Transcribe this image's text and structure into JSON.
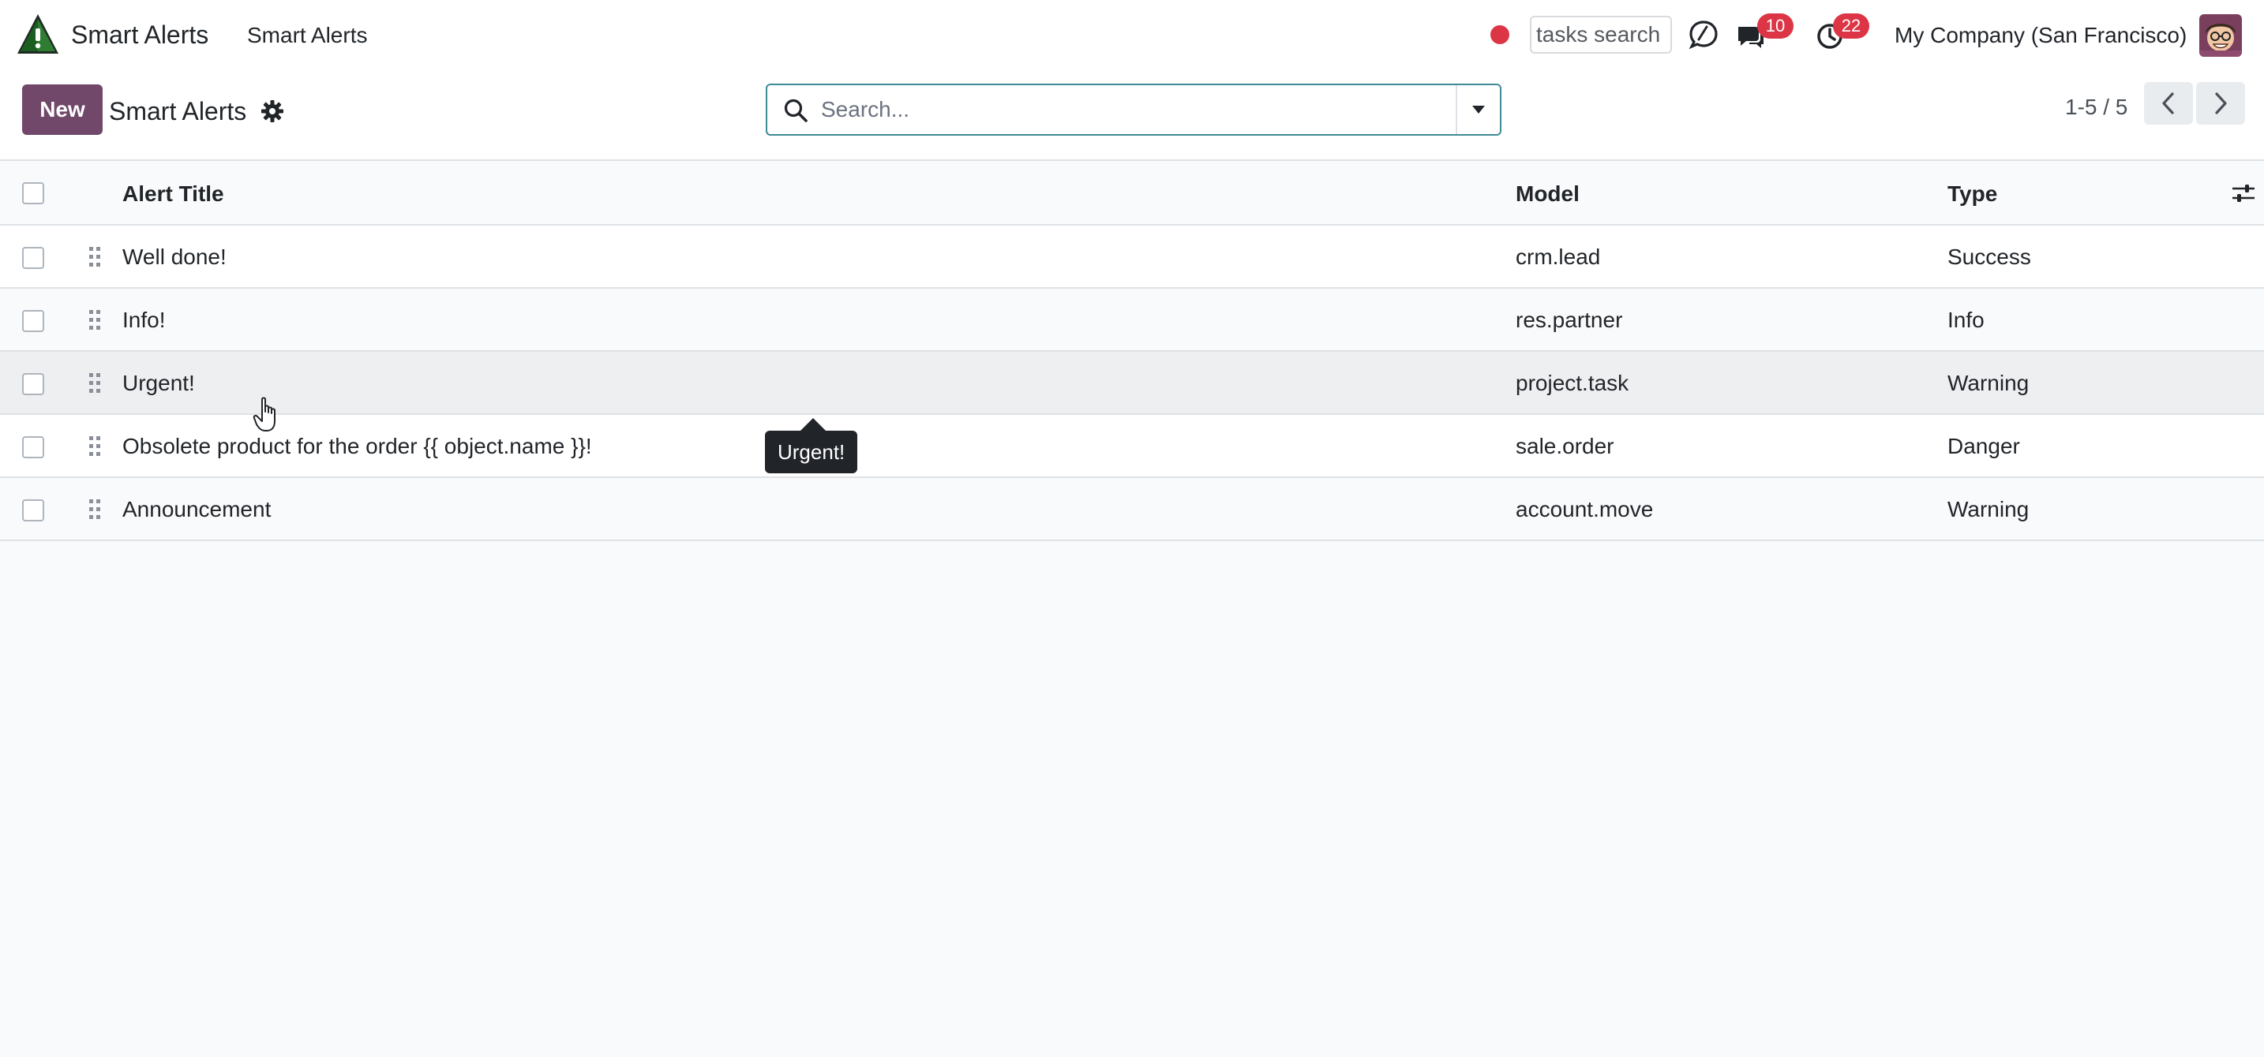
{
  "navbar": {
    "app_name": "Smart Alerts",
    "menu_item": "Smart Alerts",
    "tasks_search_placeholder": "tasks search",
    "chat_badge": "10",
    "activity_badge": "22",
    "company": "My Company (San Francisco)"
  },
  "control_panel": {
    "new_label": "New",
    "title": "Smart Alerts",
    "search_placeholder": "Search...",
    "pager": "1-5 / 5"
  },
  "table": {
    "columns": [
      "Alert Title",
      "Model",
      "Type"
    ],
    "rows": [
      {
        "title": "Well done!",
        "model": "crm.lead",
        "type": "Success"
      },
      {
        "title": "Info!",
        "model": "res.partner",
        "type": "Info"
      },
      {
        "title": "Urgent!",
        "model": "project.task",
        "type": "Warning"
      },
      {
        "title": "Obsolete product for the order {{ object.name }}!",
        "model": "sale.order",
        "type": "Danger"
      },
      {
        "title": "Announcement",
        "model": "account.move",
        "type": "Warning"
      }
    ]
  },
  "tooltip": "Urgent!",
  "colors": {
    "primary": "#71476a",
    "badge": "#dc3545",
    "search_border": "#3e8a96"
  }
}
